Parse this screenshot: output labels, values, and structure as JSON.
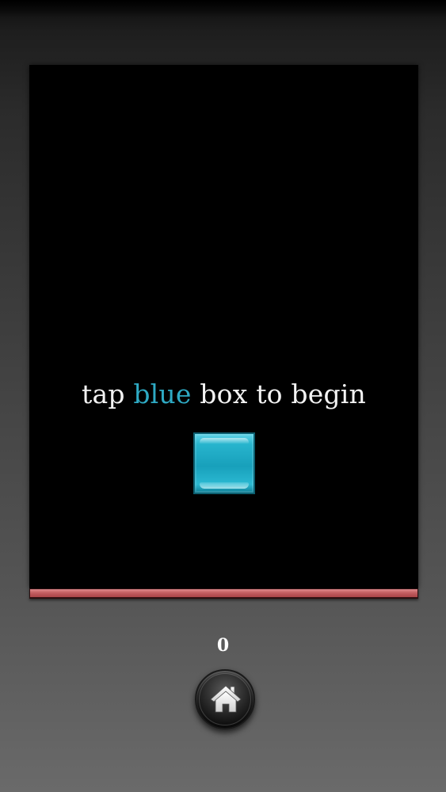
{
  "game": {
    "prompt_before": "tap ",
    "prompt_accent": "blue",
    "prompt_after": " box to begin",
    "start_box_color": "#1fa9c2",
    "score": "0",
    "timer_remaining": 1.0,
    "timer_color": "#c05a5d"
  },
  "controls": {
    "home_icon": "home-icon"
  }
}
